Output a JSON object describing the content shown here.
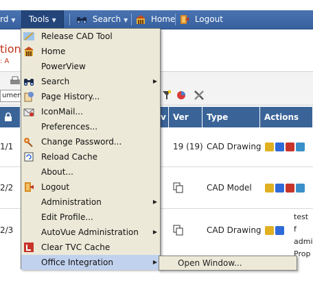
{
  "menubar": {
    "partial_item": "rd",
    "tools": "Tools",
    "search": "Search",
    "home": "Home",
    "logout": "Logout"
  },
  "page": {
    "title_fragment": "tions",
    "subtitle_fragment": ": A",
    "doc_select_fragment": "umen"
  },
  "table": {
    "headers": [
      "v",
      "Ver",
      "Type",
      "Actions"
    ],
    "rows": [
      {
        "id": "1/1",
        "ver": "19 (19)",
        "type": "CAD Drawing",
        "extra": ""
      },
      {
        "id": "2/2",
        "ver": "",
        "type": "CAD Model",
        "extra": ""
      },
      {
        "id": "2/3",
        "ver": "",
        "type": "CAD Drawing",
        "extra_lines": [
          "test f",
          "admi",
          "Prop"
        ]
      }
    ]
  },
  "tools_menu": {
    "items": [
      {
        "label": "Release CAD Tool",
        "icon": "release-cad-icon"
      },
      {
        "label": "Home",
        "icon": "home-icon"
      },
      {
        "label": "PowerView",
        "icon": ""
      },
      {
        "label": "Search",
        "icon": "binoculars-icon",
        "submenu": true
      },
      {
        "label": "Page History...",
        "icon": "page-history-icon"
      },
      {
        "label": "IconMail...",
        "icon": "iconmail-icon"
      },
      {
        "label": "Preferences...",
        "icon": ""
      },
      {
        "label": "Change Password...",
        "icon": "key-icon"
      },
      {
        "label": "Reload Cache",
        "icon": "reload-cache-icon"
      },
      {
        "label": "About...",
        "icon": ""
      },
      {
        "label": "Logout",
        "icon": "logout-icon"
      },
      {
        "label": "Administration",
        "icon": "",
        "submenu": true
      },
      {
        "label": "Edit Profile...",
        "icon": ""
      },
      {
        "label": "AutoVue Administration",
        "icon": "",
        "submenu": true
      },
      {
        "label": "Clear TVC Cache",
        "icon": "clear-cache-icon"
      },
      {
        "label": "Office Integration",
        "icon": "",
        "submenu": true,
        "highlighted": true
      }
    ]
  },
  "office_submenu": {
    "open_window": "Open Window..."
  },
  "colors": {
    "menubar": "#3f6aa8",
    "header": "#3a6498",
    "highlight": "#c1d2ee",
    "menu_bg": "#ece9d8",
    "title_red": "#c0341c"
  }
}
